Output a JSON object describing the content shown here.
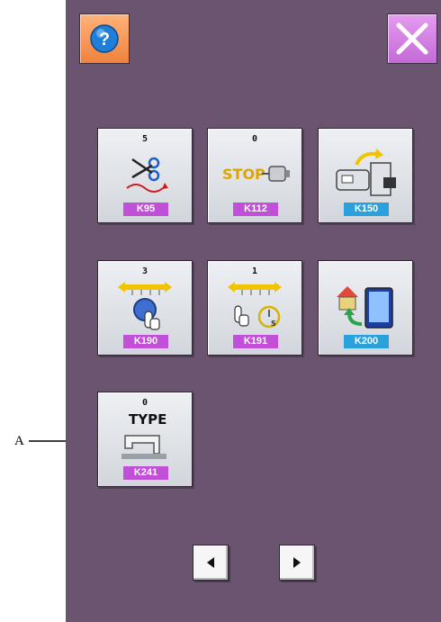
{
  "annotation": {
    "label": "A"
  },
  "header": {
    "help_icon": "question-mark-icon",
    "close_icon": "close-x-icon",
    "help_color": "#f0823e",
    "close_color": "#c36ad6"
  },
  "tiles": [
    {
      "count": "5",
      "code": "K95",
      "icon": "thread-trimmer-icon",
      "code_color": "purple"
    },
    {
      "count": "0",
      "code": "K112",
      "icon": "stop-motor-icon",
      "code_color": "purple",
      "icon_text": "STOP"
    },
    {
      "code": "K150",
      "icon": "presser-foot-lift-icon",
      "code_color": "blue"
    },
    {
      "count": "3",
      "code": "K190",
      "icon": "touch-adjust-icon",
      "code_color": "purple"
    },
    {
      "count": "1",
      "code": "K191",
      "icon": "timer-touch-icon",
      "code_color": "purple",
      "icon_text": "S"
    },
    {
      "code": "K200",
      "icon": "home-return-panel-icon",
      "code_color": "blue"
    },
    {
      "count": "0",
      "code": "K241",
      "icon": "machine-type-icon",
      "code_color": "purple",
      "icon_text": "TYPE"
    }
  ],
  "pager": {
    "prev_icon": "triangle-left-icon",
    "next_icon": "triangle-right-icon"
  },
  "colors": {
    "background": "#6b5470",
    "tile": "#e2e5ea",
    "code_purple": "#c14fd8",
    "code_blue": "#2aa1dc"
  }
}
